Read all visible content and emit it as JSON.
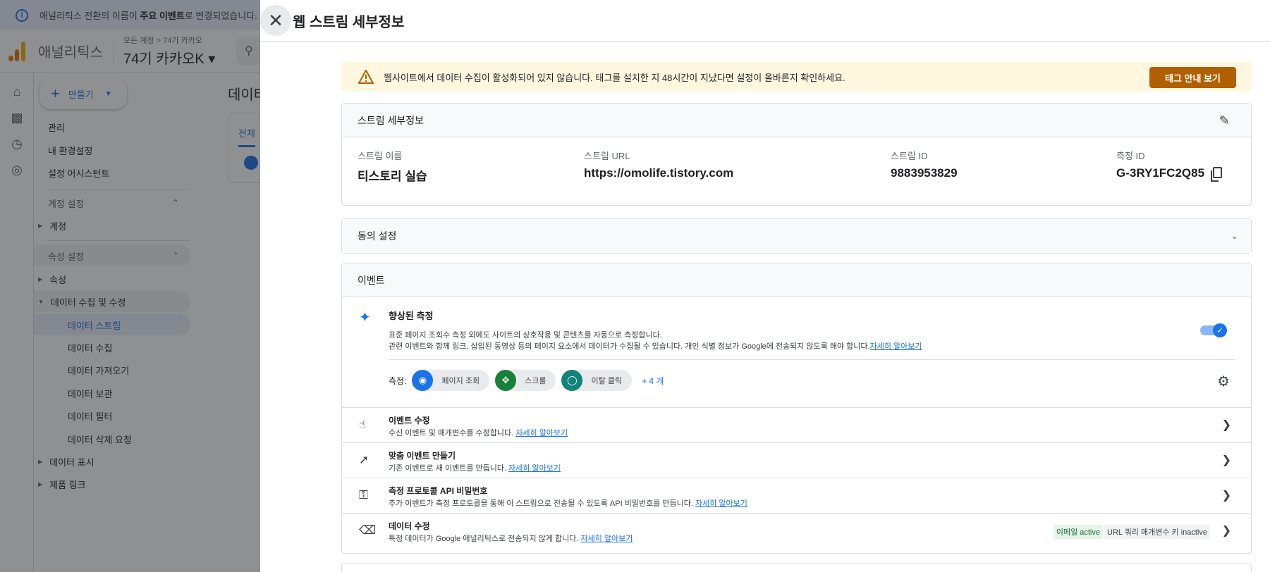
{
  "banner": {
    "pre": "애널리틱스 전환의 이름이 ",
    "bold": "주요 이벤트",
    "post": "로 변경되었습니다. 주"
  },
  "topbar": {
    "app_name": "애널리틱스",
    "crumb": "모든 계정 > 74기 카카오",
    "property": "74기 카카오K ▾"
  },
  "create": {
    "label": "만들기"
  },
  "nav": {
    "admin": "관리",
    "prefs": "내 환경설정",
    "assistant": "설정 어시스턴트",
    "account_settings": "계정 설정",
    "account": "계정",
    "property_settings": "속성 설정",
    "property": "속성",
    "data_collection": "데이터 수집 및 수정",
    "streams": "데이터 스트림",
    "collection": "데이터 수집",
    "import": "데이터 가져오기",
    "retention": "데이터 보관",
    "filters": "데이터 필터",
    "deletion": "데이터 삭제 요청",
    "display": "데이터 표시",
    "links": "제품 링크"
  },
  "bg_main": {
    "title": "데이터",
    "tab": "전체"
  },
  "panel": {
    "title": "웹 스트림 세부정보"
  },
  "alert": {
    "text": "웹사이트에서 데이터 수집이 활성화되어 있지 않습니다. 태그를 설치한 지 48시간이 지났다면 설정이 올바른지 확인하세요.",
    "button": "태그 안내 보기"
  },
  "stream": {
    "heading": "스트림 세부정보",
    "name_label": "스트림 이름",
    "name": "티스토리 실습",
    "url_label": "스트림 URL",
    "url": "https://omolife.tistory.com",
    "id_label": "스트림 ID",
    "id": "9883953829",
    "mid_label": "측정 ID",
    "mid": "G-3RY1FC2Q85"
  },
  "consent": {
    "heading": "동의 설정"
  },
  "events": {
    "heading": "이벤트",
    "enhanced_title": "향상된 측정",
    "enhanced_desc1": "표준 페이지 조회수 측정 외에도 사이트의 상호작용 및 콘텐츠를 자동으로 측정합니다.",
    "enhanced_desc2": "관련 이벤트와 함께 링크, 삽입된 동영상 등의 페이지 요소에서 데이터가 수집될 수 있습니다. 개인 식별 정보가 Google에 전송되지 않도록 해야 합니다.",
    "learn_more": "자세히 알아보기",
    "measure_label": "측정:",
    "chips": [
      {
        "label": "페이지 조회",
        "color": "#1a73e8",
        "icon": "eye-icon"
      },
      {
        "label": "스크롤",
        "color": "#188038",
        "icon": "scroll-icon"
      },
      {
        "label": "이탈 클릭",
        "color": "#12837a",
        "icon": "mouse-icon"
      }
    ],
    "more": "+ 4 개",
    "toggle_on": true
  },
  "rows": [
    {
      "title": "이벤트 수정",
      "desc": "수신 이벤트 및 매개변수를 수정합니다. ",
      "link": "자세히 알아보기",
      "icon": "touch-icon"
    },
    {
      "title": "맞춤 이벤트 만들기",
      "desc": "기존 이벤트로 새 이벤트를 만듭니다. ",
      "link": "자세히 알아보기",
      "icon": "click-sparkle-icon"
    },
    {
      "title": "측정 프로토콜 API 비밀번호",
      "desc": "추가 이벤트가 측정 프로토콜을 통해 이 스트림으로 전송될 수 있도록 API 비밀번호를 만듭니다. ",
      "link": "자세히 알아보기",
      "icon": "key-icon"
    },
    {
      "title": "데이터 수정",
      "desc": "특정 데이터가 Google 애널리틱스로 전송되지 않게 합니다. ",
      "link": "자세히 알아보기",
      "icon": "eraser-icon",
      "badge_active": "이메일 active",
      "badge_inactive": "URL 쿼리 매개변수 키 inactive"
    }
  ]
}
